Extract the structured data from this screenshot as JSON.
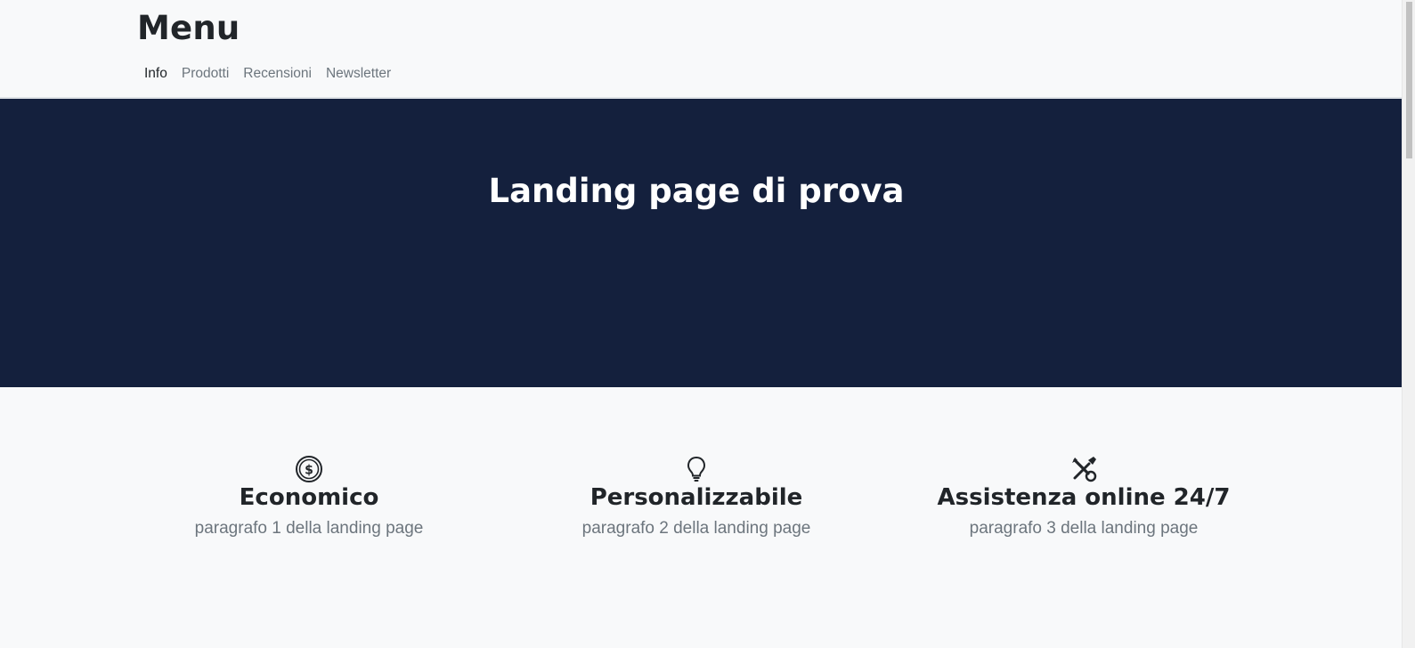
{
  "header": {
    "brand": "Menu",
    "nav": [
      {
        "label": "Info",
        "active": true
      },
      {
        "label": "Prodotti",
        "active": false
      },
      {
        "label": "Recensioni",
        "active": false
      },
      {
        "label": "Newsletter",
        "active": false
      }
    ]
  },
  "hero": {
    "title": "Landing page di prova",
    "background_color": "#14203d"
  },
  "features": [
    {
      "icon": "currency-dollar-icon",
      "title": "Economico",
      "text": "paragrafo 1 della landing page"
    },
    {
      "icon": "lightbulb-icon",
      "title": "Personalizzabile",
      "text": "paragrafo 2 della landing page"
    },
    {
      "icon": "tools-icon",
      "title": "Assistenza online 24/7",
      "text": "paragrafo 3 della landing page"
    }
  ]
}
